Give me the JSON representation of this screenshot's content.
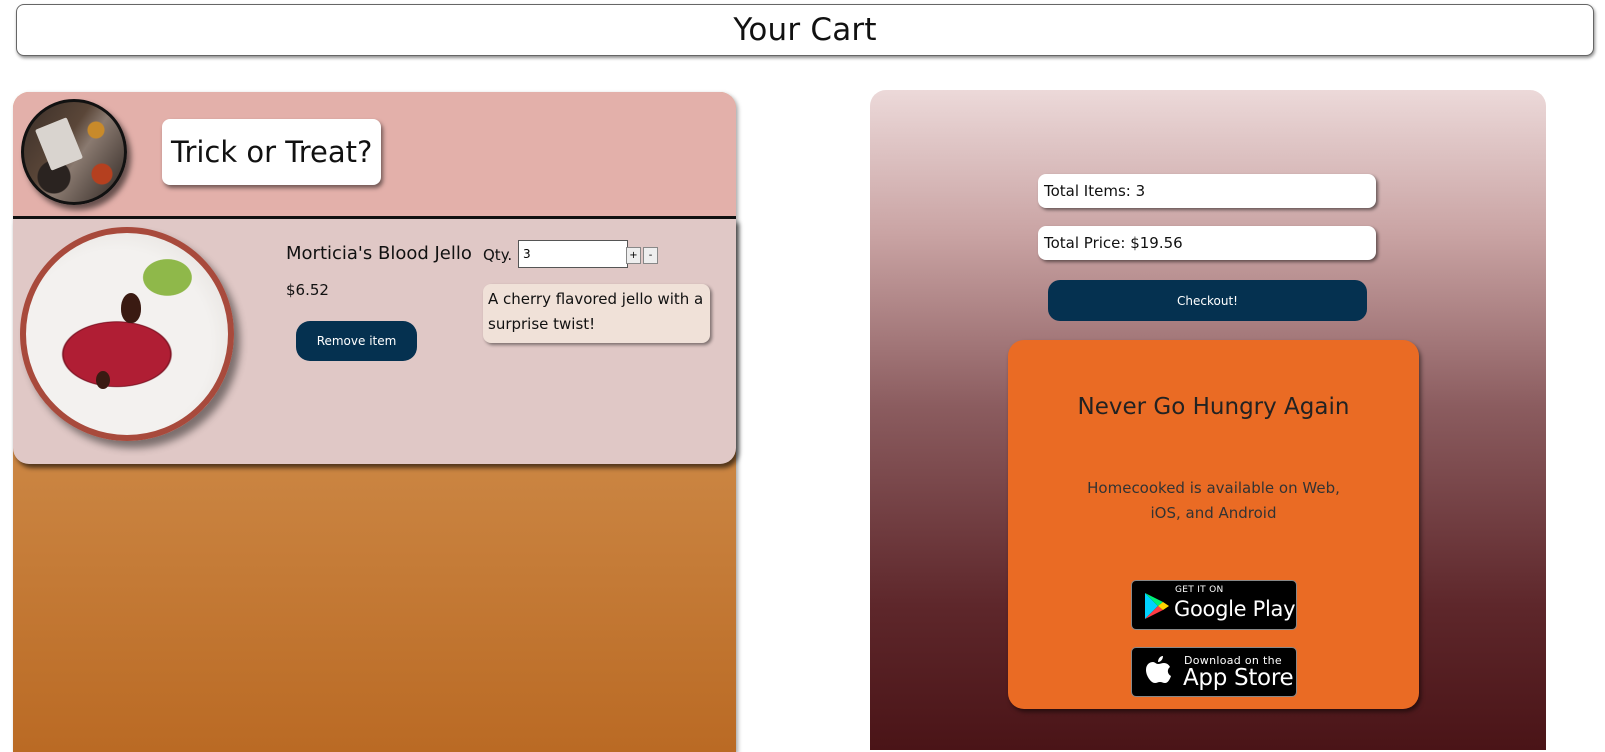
{
  "header": {
    "title": "Your Cart"
  },
  "restaurant": {
    "name": "Trick or Treat?",
    "logo_icon": "restaurant-logo-image"
  },
  "cart_items": [
    {
      "name": "Morticia's Blood Jello",
      "price": "$6.52",
      "quantity_label": "Qty.",
      "quantity": "3",
      "increment_label": "+",
      "decrement_label": "-",
      "remove_label": "Remove item",
      "description": "A cherry flavored jello with a surprise twist!"
    }
  ],
  "summary": {
    "total_items": "Total Items: 3",
    "total_price": "Total Price: $19.56",
    "checkout_label": "Checkout!"
  },
  "promo": {
    "title": "Never Go Hungry Again",
    "text": "Homecooked is available on Web, iOS, and Android",
    "google_play": {
      "small": "GET IT ON",
      "big": "Google Play"
    },
    "app_store": {
      "small": "Download on the",
      "big": "App Store"
    }
  },
  "colors": {
    "button_navy": "#053150",
    "promo_orange": "#ea6b24",
    "restaurant_header": "#e3b0aa",
    "item_card": "#e0c8c6"
  }
}
